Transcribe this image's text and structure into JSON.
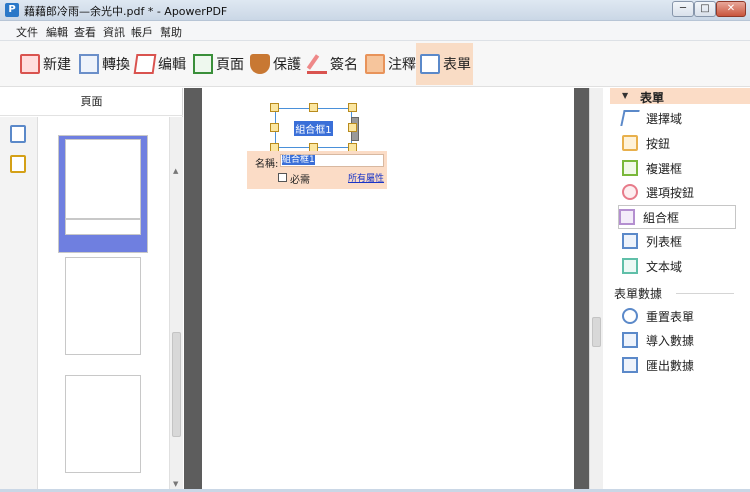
{
  "window": {
    "app_icon": "P",
    "title": "藉藉郎冷雨—余光中.pdf * - ApowerPDF",
    "controls": {
      "minimize": "─",
      "maximize": "□",
      "close": "✕"
    }
  },
  "menubar": [
    "文件",
    "編輯",
    "查看",
    "資訊",
    "帳戶",
    "幫助"
  ],
  "toolbar": [
    {
      "id": "new",
      "label": "新建",
      "icon": "new-icon"
    },
    {
      "id": "convert",
      "label": "轉換",
      "icon": "convert-icon"
    },
    {
      "id": "edit",
      "label": "编輯",
      "icon": "edit-icon"
    },
    {
      "id": "page",
      "label": "頁面",
      "icon": "page-icon"
    },
    {
      "id": "protect",
      "label": "保護",
      "icon": "shield-icon"
    },
    {
      "id": "sign",
      "label": "簽名",
      "icon": "pen-icon"
    },
    {
      "id": "annotate",
      "label": "注釋",
      "icon": "comment-icon"
    },
    {
      "id": "form",
      "label": "表單",
      "icon": "form-icon",
      "active": true
    }
  ],
  "left_panel": {
    "header": "頁面",
    "scroll_arrows": {
      "up": "▲",
      "down": "▼"
    }
  },
  "document": {
    "combo_field_name": "組合框1",
    "properties": {
      "name_label": "名稱:",
      "name_value": "組合框1",
      "required_label": "必需",
      "all_properties_link": "所有屬性"
    }
  },
  "right_panel": {
    "header": "表單",
    "header_arrow": "▼",
    "tools": [
      {
        "label": "選擇域",
        "icon": "cursor-icon"
      },
      {
        "label": "按鈕",
        "icon": "button-icon"
      },
      {
        "label": "複選框",
        "icon": "checkbox-icon"
      },
      {
        "label": "選項按鈕",
        "icon": "radio-icon"
      },
      {
        "label": "組合框",
        "icon": "combo-icon",
        "selected": true
      },
      {
        "label": "列表框",
        "icon": "list-icon"
      },
      {
        "label": "文本域",
        "icon": "text-field-icon"
      }
    ],
    "data_section": "表單數據",
    "data_tools": [
      {
        "label": "重置表單",
        "icon": "reset-icon"
      },
      {
        "label": "導入數據",
        "icon": "import-icon"
      },
      {
        "label": "匯出數據",
        "icon": "export-icon"
      }
    ]
  },
  "colors": {
    "accent": "#fbdcc6",
    "selection": "#3a6fd8",
    "thumbnail_selected": "#6f7fe0"
  }
}
